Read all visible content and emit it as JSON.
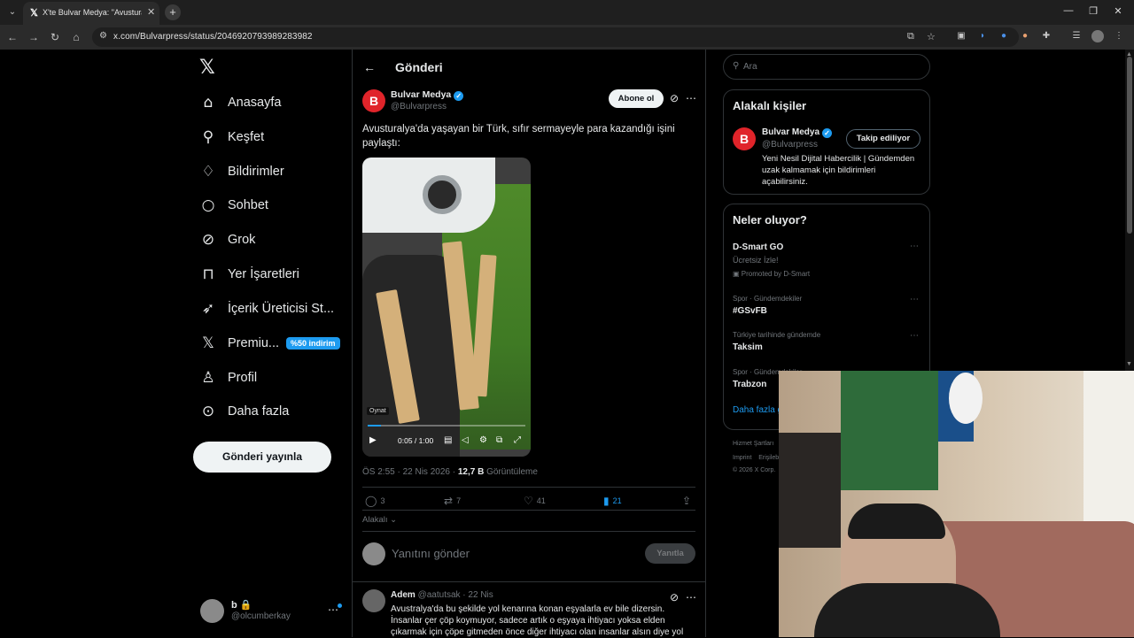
{
  "browser": {
    "tab_title": "X'te Bulvar Medya: \"Avusturalya",
    "url": "x.com/Bulvarpress/status/2046920793989283982"
  },
  "nav": {
    "items": [
      {
        "label": "Anasayfa",
        "icon": "home-icon"
      },
      {
        "label": "Keşfet",
        "icon": "search-icon"
      },
      {
        "label": "Bildirimler",
        "icon": "bell-icon"
      },
      {
        "label": "Sohbet",
        "icon": "chat-icon"
      },
      {
        "label": "Grok",
        "icon": "grok-icon"
      },
      {
        "label": "Yer İşaretleri",
        "icon": "bookmark-icon"
      },
      {
        "label": "İçerik Üreticisi St...",
        "icon": "rocket-icon"
      },
      {
        "label": "Premiu...",
        "icon": "x-icon"
      },
      {
        "label": "Profil",
        "icon": "person-icon"
      },
      {
        "label": "Daha fazla",
        "icon": "more-circle-icon"
      }
    ],
    "premium_badge": "%50 indirim",
    "post_button": "Gönderi yayınla",
    "me_name": "b",
    "me_handle": "@olcumberkay"
  },
  "header": {
    "title": "Gönderi"
  },
  "post": {
    "name": "Bulvar Medya",
    "handle": "@Bulvarpress",
    "subscribe": "Abone ol",
    "text": "Avusturalya'da yaşayan bir Türk, sıfır sermayeyle para kazandığı işini paylaştı:",
    "video": {
      "label": "Oynat",
      "time": "0:05 / 1:00",
      "progress": 0.083
    },
    "time": "ÖS 2:55 · 22 Nis 2026 · ",
    "views_count": "12,7 B",
    "views_label": " Görüntüleme",
    "replies": "3",
    "reposts": "7",
    "likes": "41",
    "bookmarks": "21",
    "relevant": "Alakalı"
  },
  "reply": {
    "placeholder": "Yanıtını gönder",
    "button": "Yanıtla"
  },
  "comment": {
    "name": "Adem",
    "meta": " @aatutsak · 22 Nis",
    "text": "Avustralya'da bu şekilde yol kenarına konan eşyalarla ev bile dizersin. İnsanlar çer çöp koymuyor,  sadece artık o eşyaya ihtiyacı yoksa elden çıkarmak için çöpe gitmeden önce diğer ihtiyacı olan insanlar alsın diye yol"
  },
  "search": {
    "placeholder": "Ara"
  },
  "related": {
    "title": "Alakalı kişiler",
    "name": "Bulvar Medya",
    "handle": "@Bulvarpress",
    "button": "Takip ediliyor",
    "bio": "Yeni Nesil Dijital Habercilik | Gündemden uzak kalmamak için bildirimleri açabilirsiniz."
  },
  "trends": {
    "title": "Neler oluyor?",
    "items": [
      {
        "category": "",
        "name": "D-Smart GO",
        "sub": "Ücretsiz İzle!",
        "promo": "Promoted by D-Smart"
      },
      {
        "category": "Spor · Gündemdekiler",
        "name": "#GSvFB"
      },
      {
        "category": "Türkiye tarihinde gündemde",
        "name": "Taksim"
      },
      {
        "category": "Spor · Gündemdekiler",
        "name": "Trabzon"
      }
    ],
    "more": "Daha fazla göster"
  },
  "footer": {
    "line1": "Hizmet Şartları",
    "line2": "Imprint",
    "line3": "Erişilebilirlik",
    "line4": "© 2026 X Corp."
  },
  "colors": {
    "accent": "#1d9bf0",
    "brand_red": "#e0242a",
    "background": "#000000"
  }
}
